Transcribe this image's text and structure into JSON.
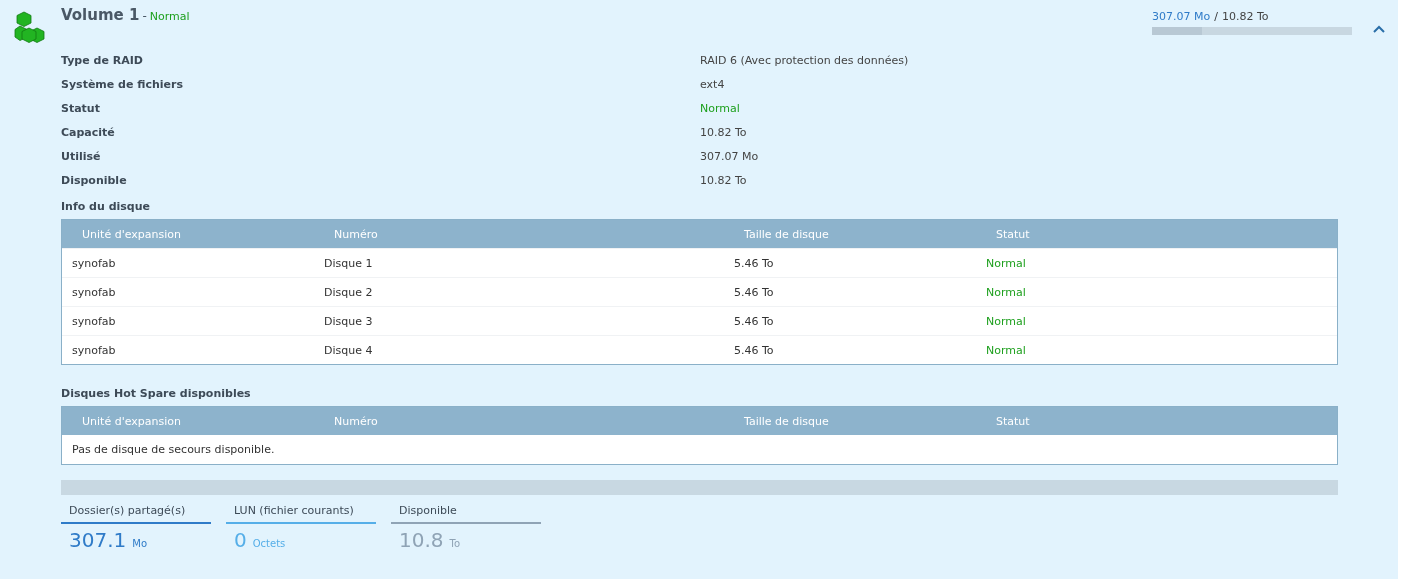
{
  "volume": {
    "title": "Volume 1",
    "separator": "-",
    "status": "Normal",
    "used": "307.07 Mo",
    "slash": "/",
    "total": "10.82 To",
    "level": 0.25,
    "expanded": true
  },
  "details": [
    {
      "label": "Type de RAID",
      "value": "RAID 6 (Avec protection des données)",
      "kind": "plain"
    },
    {
      "label": "Système de fichiers",
      "value": "ext4",
      "kind": "plain"
    },
    {
      "label": "Statut",
      "value": "Normal",
      "kind": "status"
    },
    {
      "label": "Capacité",
      "value": "10.82 To",
      "kind": "plain"
    },
    {
      "label": "Utilisé",
      "value": "307.07 Mo",
      "kind": "plain"
    },
    {
      "label": "Disponible",
      "value": "10.82 To",
      "kind": "plain"
    }
  ],
  "disk_table": {
    "title": "Info du disque",
    "columns": [
      "Unité d'expansion",
      "Numéro",
      "Taille de disque",
      "Statut"
    ],
    "rows": [
      [
        "synofab",
        "Disque 1",
        "5.46 To",
        "Normal"
      ],
      [
        "synofab",
        "Disque 2",
        "5.46 To",
        "Normal"
      ],
      [
        "synofab",
        "Disque 3",
        "5.46 To",
        "Normal"
      ],
      [
        "synofab",
        "Disque 4",
        "5.46 To",
        "Normal"
      ]
    ]
  },
  "spare_table": {
    "title": "Disques Hot Spare disponibles",
    "columns": [
      "Unité d'expansion",
      "Numéro",
      "Taille de disque",
      "Statut"
    ],
    "empty_text": "Pas de disque de secours disponible."
  },
  "legend": [
    {
      "label": "Dossier(s) partagé(s)",
      "value": "307.1",
      "unit": "Mo",
      "color": "#2f7bc8"
    },
    {
      "label": "LUN (fichier courants)",
      "value": "0",
      "unit": "Octets",
      "color": "#55aee8"
    },
    {
      "label": "Disponible",
      "value": "10.8",
      "unit": "To",
      "color": "#8fa3b5"
    }
  ]
}
